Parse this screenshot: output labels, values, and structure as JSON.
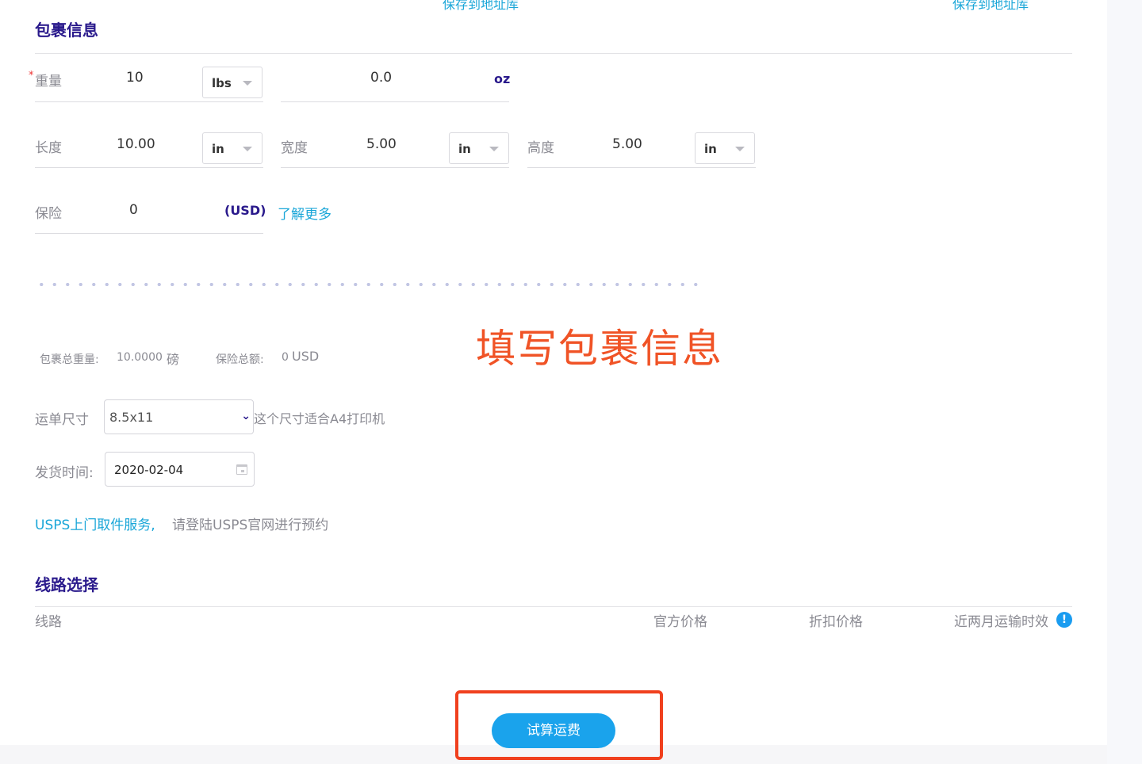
{
  "header": {
    "save_address_left": "保存到地址库",
    "save_address_right": "保存到地址库"
  },
  "package": {
    "title": "包裹信息",
    "weight": {
      "required_mark": "*",
      "label": "重量",
      "value": "10",
      "unit": "lbs",
      "oz_value": "0.0",
      "oz_unit": "oz"
    },
    "length": {
      "label": "长度",
      "value": "10.00",
      "unit": "in"
    },
    "width": {
      "label": "宽度",
      "value": "5.00",
      "unit": "in"
    },
    "height": {
      "label": "高度",
      "value": "5.00",
      "unit": "in"
    },
    "insurance": {
      "label": "保险",
      "value": "0",
      "currency": "(USD)",
      "learn_more": "了解更多"
    }
  },
  "summary": {
    "total_weight_label": "包裹总重量:",
    "total_weight_value": "10.0000",
    "total_weight_unit": "磅",
    "insurance_total_label": "保险总额:",
    "insurance_total_value": "0",
    "insurance_total_unit": "USD"
  },
  "annotation": "填写包裹信息",
  "label_size": {
    "label": "运单尺寸",
    "selected": "8.5x11",
    "hint": "这个尺寸适合A4打印机"
  },
  "ship_date": {
    "label": "发货时间:",
    "value": "2020-02-04"
  },
  "usps": {
    "link": "USPS上门取件服务,",
    "text": "请登陆USPS官网进行预约"
  },
  "routes": {
    "title": "线路选择",
    "columns": [
      "线路",
      "官方价格",
      "折扣价格",
      "近两月运输时效"
    ],
    "info_icon": "!"
  },
  "calculate_button": "试算运费",
  "colors": {
    "accent": "#1aa3ec",
    "title": "#2a1a8c",
    "annotation": "#f05326"
  }
}
